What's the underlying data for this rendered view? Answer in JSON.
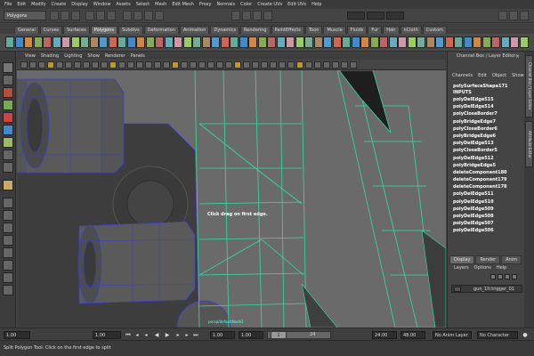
{
  "menubar": [
    "File",
    "Edit",
    "Modify",
    "Create",
    "Display",
    "Window",
    "Assets",
    "Select",
    "Mesh",
    "Edit Mesh",
    "Proxy",
    "Normals",
    "Color",
    "Create UVs",
    "Edit UVs",
    "Help"
  ],
  "status_line": {
    "menu_set": "Polygons"
  },
  "shelf_tabs": [
    {
      "label": "General",
      "active": false
    },
    {
      "label": "Curves",
      "active": false
    },
    {
      "label": "Surfaces",
      "active": false
    },
    {
      "label": "Polygons",
      "active": true
    },
    {
      "label": "Subdivs",
      "active": false
    },
    {
      "label": "Deformation",
      "active": false
    },
    {
      "label": "Animation",
      "active": false
    },
    {
      "label": "Dynamics",
      "active": false
    },
    {
      "label": "Rendering",
      "active": false
    },
    {
      "label": "PaintEffects",
      "active": false
    },
    {
      "label": "Toon",
      "active": false
    },
    {
      "label": "Muscle",
      "active": false
    },
    {
      "label": "Fluids",
      "active": false
    },
    {
      "label": "Fur",
      "active": false
    },
    {
      "label": "Hair",
      "active": false
    },
    {
      "label": "nCloth",
      "active": false
    },
    {
      "label": "Custom",
      "active": false
    }
  ],
  "viewport": {
    "menu": [
      "View",
      "Shading",
      "Lighting",
      "Show",
      "Renderer",
      "Panels"
    ],
    "hint": "Click drag on first edge.",
    "camera_label": "persp/defaultNode1"
  },
  "channel_box": {
    "title": "Channel Box / Layer Editor",
    "menu": [
      "Channels",
      "Edit",
      "Object",
      "Show"
    ],
    "node": "polySurfaceShape171",
    "inputs_label": "INPUTS",
    "history": [
      "polyDelEdge515",
      "polyDelEdge514",
      "polyCloseBorder7",
      "polyBridgeEdge7",
      "polyCloseBorder6",
      "polyBridgeEdge6",
      "polyDelEdge513",
      "polyCloseBorder5",
      "polyDelEdge512",
      "polyBridgeEdge5",
      "deleteComponent180",
      "deleteComponent179",
      "deleteComponent178",
      "polyDelEdge511",
      "polyDelEdge510",
      "polyDelEdge509",
      "polyDelEdge508",
      "polyDelEdge507",
      "polyDelEdge506"
    ]
  },
  "layer_editor": {
    "tabs": [
      {
        "label": "Display",
        "active": true
      },
      {
        "label": "Render",
        "active": false
      },
      {
        "label": "Anim",
        "active": false
      }
    ],
    "menu": [
      "Layers",
      "Options",
      "Help"
    ],
    "layer_name": "gun_1lt:trigger_01"
  },
  "side_tabs": [
    "Channel Box / Layer Editor",
    "Attribute Editor"
  ],
  "time_slider": {
    "start": "1.00",
    "current": "1.00",
    "range_start": "1.00",
    "range_handle": "1",
    "range_end_mark": "24",
    "end": "24.00",
    "anim_end": "48.00",
    "anim_layer": "No Anim Layer",
    "character_set": "No Character Set"
  },
  "help_line": "Split Polygon Tool: Click on the first edge to split",
  "colors": {
    "wire": "#3b3bd6",
    "selected_wire": "#2fe0a0",
    "panel": "#444444",
    "viewport": "#6b6b6b"
  }
}
